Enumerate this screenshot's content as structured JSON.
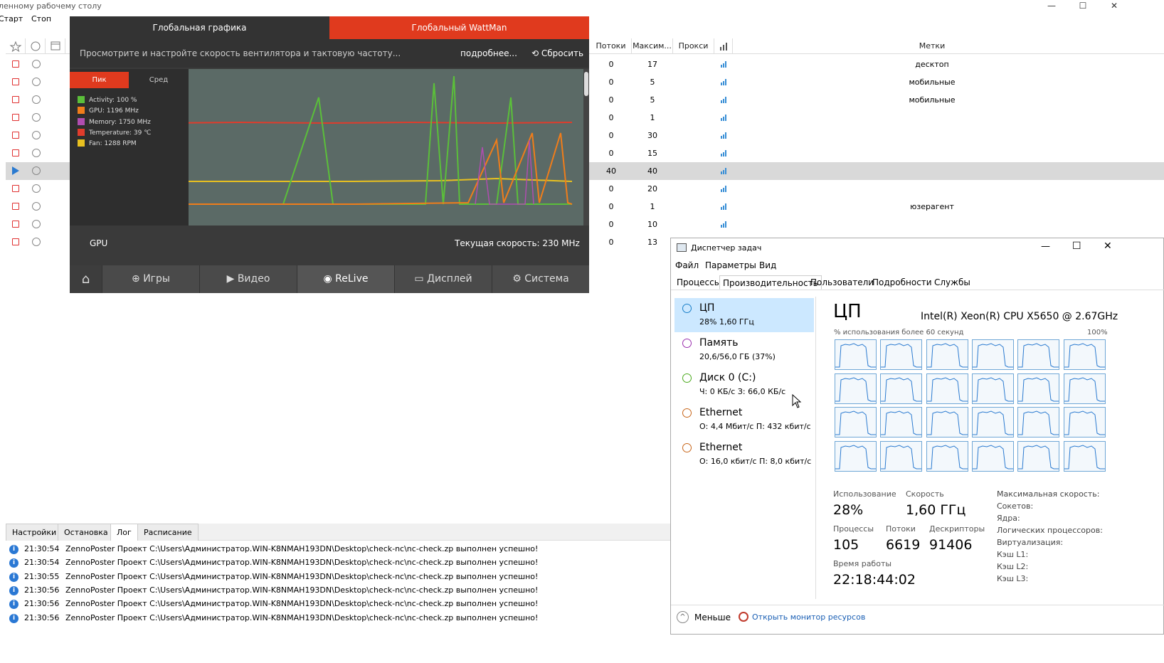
{
  "window_title": "ленному рабочему столу",
  "toolbar": {
    "start": "Старт",
    "stop": "Стоп"
  },
  "grid": {
    "headers": {
      "threads": "Потоки",
      "max": "Максим...",
      "proxy": "Прокси",
      "tags": "Метки"
    },
    "rows": [
      {
        "threads": "0",
        "max": "17",
        "tag": "десктоп"
      },
      {
        "threads": "0",
        "max": "5",
        "tag": "мобильные"
      },
      {
        "threads": "0",
        "max": "5",
        "tag": "мобильные"
      },
      {
        "threads": "0",
        "max": "1",
        "tag": ""
      },
      {
        "threads": "0",
        "max": "30",
        "tag": ""
      },
      {
        "threads": "0",
        "max": "15",
        "tag": ""
      },
      {
        "threads": "40",
        "max": "40",
        "tag": ""
      },
      {
        "threads": "0",
        "max": "20",
        "tag": ""
      },
      {
        "threads": "0",
        "max": "1",
        "tag": "юзерагент"
      },
      {
        "threads": "0",
        "max": "10",
        "tag": ""
      },
      {
        "threads": "0",
        "max": "13",
        "tag": ""
      }
    ]
  },
  "amd": {
    "tab_global_graphics": "Глобальная графика",
    "tab_wattman": "Глобальный WattMan",
    "subtitle": "Просмотрите и настройте скорость вентилятора и тактовую частоту...",
    "more": "подробнее...",
    "reset": "Сбросить",
    "peak": "Пик",
    "avg": "Сред",
    "legend": [
      {
        "label": "Activity: 100 %",
        "color": "#5bbf3a"
      },
      {
        "label": "GPU: 1196 MHz",
        "color": "#f07d1a"
      },
      {
        "label": "Memory: 1750 MHz",
        "color": "#b04db0"
      },
      {
        "label": "Temperature: 39 ℃",
        "color": "#e03c2c"
      },
      {
        "label": "Fan: 1288 RPM",
        "color": "#e8c020"
      }
    ],
    "gpu_label": "GPU",
    "current_speed": "Текущая скорость: 230 MHz",
    "nav": {
      "games": "Игры",
      "video": "Видео",
      "relive": "ReLive",
      "display": "Дисплей",
      "system": "Система"
    },
    "accent": "#e03a1e"
  },
  "bottom_tabs": {
    "settings": "Настройки",
    "stop": "Остановка",
    "log": "Лог",
    "schedule": "Расписание"
  },
  "log": [
    {
      "time": "21:30:54",
      "msg": "ZennoPoster Проект C:\\Users\\Администратор.WIN-K8NMAH193DN\\Desktop\\check-nc\\nc-check.zp выполнен успешно!"
    },
    {
      "time": "21:30:54",
      "msg": "ZennoPoster Проект C:\\Users\\Администратор.WIN-K8NMAH193DN\\Desktop\\check-nc\\nc-check.zp выполнен успешно!"
    },
    {
      "time": "21:30:55",
      "msg": "ZennoPoster Проект C:\\Users\\Администратор.WIN-K8NMAH193DN\\Desktop\\check-nc\\nc-check.zp выполнен успешно!"
    },
    {
      "time": "21:30:56",
      "msg": "ZennoPoster Проект C:\\Users\\Администратор.WIN-K8NMAH193DN\\Desktop\\check-nc\\nc-check.zp выполнен успешно!"
    },
    {
      "time": "21:30:56",
      "msg": "ZennoPoster Проект C:\\Users\\Администратор.WIN-K8NMAH193DN\\Desktop\\check-nc\\nc-check.zp выполнен успешно!"
    },
    {
      "time": "21:30:56",
      "msg": "ZennoPoster Проект C:\\Users\\Администратор.WIN-K8NMAH193DN\\Desktop\\check-nc\\nc-check.zp выполнен успешно!"
    }
  ],
  "taskmgr": {
    "title": "Диспетчер задач",
    "menu": {
      "file": "Файл",
      "params": "Параметры",
      "view": "Вид"
    },
    "tabs": {
      "processes": "Процессы",
      "performance": "Производительность",
      "users": "Пользователи",
      "details": "Подробности",
      "services": "Службы"
    },
    "side": [
      {
        "name": "ЦП",
        "value": "28% 1,60 ГГц",
        "color": "#1a7fc8"
      },
      {
        "name": "Память",
        "value": "20,6/56,0 ГБ (37%)",
        "color": "#9b2fae"
      },
      {
        "name": "Диск 0 (C:)",
        "value": "Ч: 0 КБ/с З: 66,0 КБ/с",
        "color": "#4caa1e"
      },
      {
        "name": "Ethernet",
        "value": "О: 4,4 Мбит/с П: 432 кбит/с",
        "color": "#c8661a"
      },
      {
        "name": "Ethernet",
        "value": "О: 16,0 кбит/с П: 8,0 кбит/с",
        "color": "#c8661a"
      }
    ],
    "cpu_title": "ЦП",
    "cpu_model": "Intel(R) Xeon(R) CPU X5650 @ 2.67GHz",
    "usage_caption": "% использования более 60 секунд",
    "pct100": "100%",
    "stats": {
      "usage_l": "Использование",
      "usage_v": "28%",
      "speed_l": "Скорость",
      "speed_v": "1,60 ГГц",
      "proc_l": "Процессы",
      "proc_v": "105",
      "thr_l": "Потоки",
      "thr_v": "6619",
      "hnd_l": "Дескрипторы",
      "hnd_v": "91406",
      "up_l": "Время работы",
      "up_v": "22:18:44:02"
    },
    "right_keys": [
      "Максимальная скорость:",
      "Сокетов:",
      "Ядра:",
      "Логических процессоров:",
      "Виртуализация:",
      "Кэш L1:",
      "Кэш L2:",
      "Кэш L3:"
    ],
    "fewer": "Меньше",
    "open_monitor": "Открыть монитор ресурсов"
  }
}
